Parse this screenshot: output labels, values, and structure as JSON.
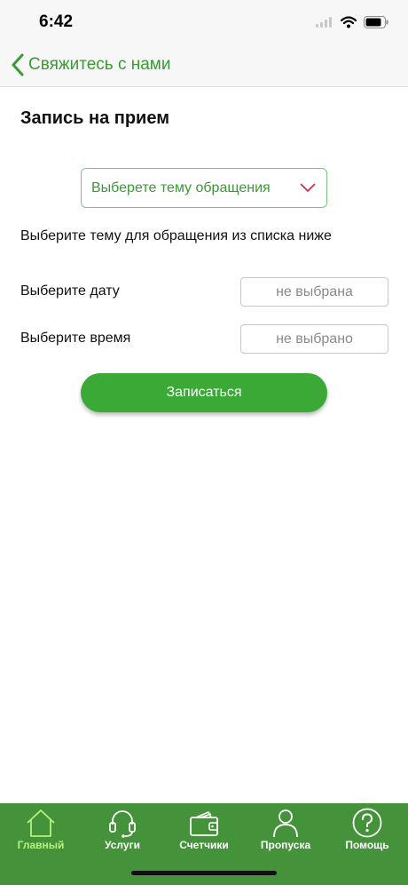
{
  "status": {
    "time": "6:42"
  },
  "nav": {
    "back_label": "Свяжитесь с нами"
  },
  "form": {
    "title": "Запись на прием",
    "topic_select": {
      "placeholder": "Выберете тему обращения"
    },
    "hint": "Выберите тему для обращения из списка ниже",
    "date": {
      "label": "Выберите дату",
      "value": "не выбрана"
    },
    "time": {
      "label": "Выберите время",
      "value": "не выбрано"
    },
    "submit_label": "Записаться"
  },
  "tabbar": {
    "items": [
      {
        "label": "Главный",
        "icon": "home-icon",
        "active": true
      },
      {
        "label": "Услуги",
        "icon": "headset-icon",
        "active": false
      },
      {
        "label": "Счетчики",
        "icon": "wallet-icon",
        "active": false
      },
      {
        "label": "Пропуска",
        "icon": "person-icon",
        "active": false
      },
      {
        "label": "Помощь",
        "icon": "help-icon",
        "active": false
      }
    ]
  },
  "colors": {
    "accent": "#3a9a34",
    "tabbar_bg": "#44923a",
    "active_tab": "#b6f37a",
    "chevron": "#d0274a"
  }
}
